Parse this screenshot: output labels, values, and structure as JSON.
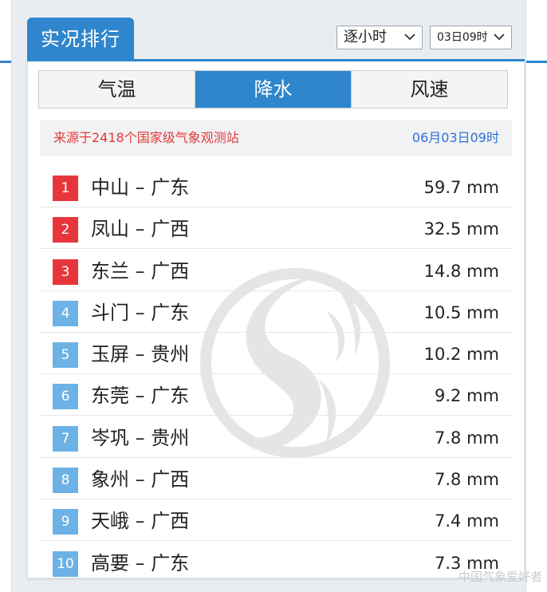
{
  "header": {
    "title": "实况排行"
  },
  "selectors": {
    "mode": "逐小时",
    "time": "03日09时"
  },
  "tabs": [
    {
      "label": "气温",
      "active": false
    },
    {
      "label": "降水",
      "active": true
    },
    {
      "label": "风速",
      "active": false
    }
  ],
  "info": {
    "source": "来源于2418个国家级气象观测站",
    "timestamp": "06月03日09时"
  },
  "rankings": [
    {
      "rank": "1",
      "name": "中山 – 广东",
      "value": "59.7 mm"
    },
    {
      "rank": "2",
      "name": "凤山 – 广西",
      "value": "32.5 mm"
    },
    {
      "rank": "3",
      "name": "东兰 – 广西",
      "value": "14.8 mm"
    },
    {
      "rank": "4",
      "name": "斗门 – 广东",
      "value": "10.5 mm"
    },
    {
      "rank": "5",
      "name": "玉屏 – 贵州",
      "value": "10.2 mm"
    },
    {
      "rank": "6",
      "name": "东莞 – 广东",
      "value": "9.2 mm"
    },
    {
      "rank": "7",
      "name": "岑巩 – 贵州",
      "value": "7.8 mm"
    },
    {
      "rank": "8",
      "name": "象州 – 广西",
      "value": "7.8 mm"
    },
    {
      "rank": "9",
      "name": "天峨 – 广西",
      "value": "7.4 mm"
    },
    {
      "rank": "10",
      "name": "高要 – 广东",
      "value": "7.3 mm"
    }
  ],
  "footer": {
    "credit": "中国气象爱好者"
  },
  "colors": {
    "accent": "#2f86cc",
    "top_rank": "#e6363c",
    "other_rank": "#6db2e6",
    "source_text": "#e53a3a",
    "time_text": "#2f6fd6"
  },
  "icons": {
    "dropdown": "chevron-down-icon",
    "watermark": "dragon-emblem-watermark"
  }
}
